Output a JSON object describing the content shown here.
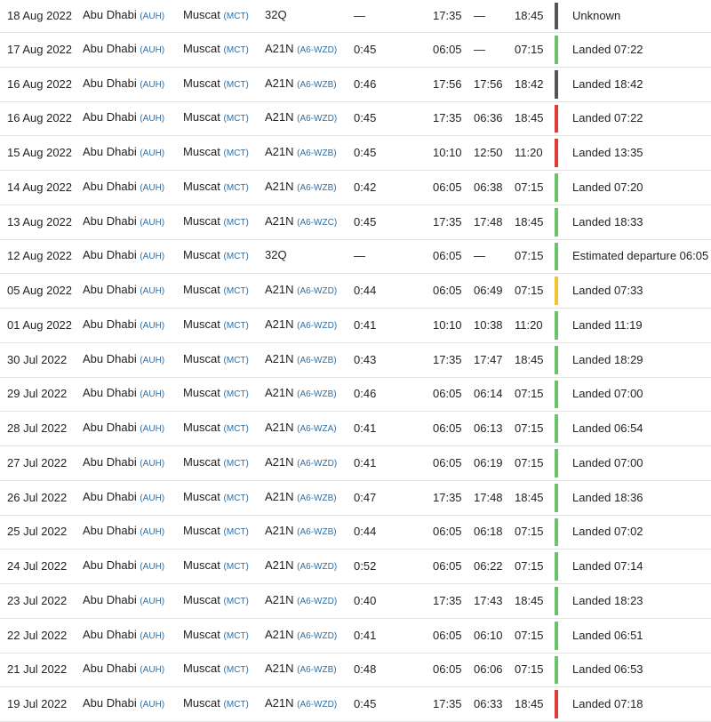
{
  "colors": {
    "grey": "#555555",
    "green": "#6cc26c",
    "red": "#de3b3b",
    "yellow": "#f1c232",
    "code_link": "#2f6ea3"
  },
  "flights": [
    {
      "date": "18 Aug 2022",
      "from_city": "Abu Dhabi",
      "from_code": "(AUH)",
      "to_city": "Muscat",
      "to_code": "(MCT)",
      "aircraft": "32Q",
      "registration": "",
      "duration": "—",
      "std": "17:35",
      "atd": "—",
      "sta": "18:45",
      "status": "Unknown",
      "status_color": "grey"
    },
    {
      "date": "17 Aug 2022",
      "from_city": "Abu Dhabi",
      "from_code": "(AUH)",
      "to_city": "Muscat",
      "to_code": "(MCT)",
      "aircraft": "A21N",
      "registration": "(A6-WZD)",
      "duration": "0:45",
      "std": "06:05",
      "atd": "—",
      "sta": "07:15",
      "status": "Landed 07:22",
      "status_color": "green"
    },
    {
      "date": "16 Aug 2022",
      "from_city": "Abu Dhabi",
      "from_code": "(AUH)",
      "to_city": "Muscat",
      "to_code": "(MCT)",
      "aircraft": "A21N",
      "registration": "(A6-WZB)",
      "duration": "0:46",
      "std": "17:56",
      "atd": "17:56",
      "sta": "18:42",
      "status": "Landed 18:42",
      "status_color": "grey"
    },
    {
      "date": "16 Aug 2022",
      "from_city": "Abu Dhabi",
      "from_code": "(AUH)",
      "to_city": "Muscat",
      "to_code": "(MCT)",
      "aircraft": "A21N",
      "registration": "(A6-WZD)",
      "duration": "0:45",
      "std": "17:35",
      "atd": "06:36",
      "sta": "18:45",
      "status": "Landed 07:22",
      "status_color": "red"
    },
    {
      "date": "15 Aug 2022",
      "from_city": "Abu Dhabi",
      "from_code": "(AUH)",
      "to_city": "Muscat",
      "to_code": "(MCT)",
      "aircraft": "A21N",
      "registration": "(A6-WZB)",
      "duration": "0:45",
      "std": "10:10",
      "atd": "12:50",
      "sta": "11:20",
      "status": "Landed 13:35",
      "status_color": "red"
    },
    {
      "date": "14 Aug 2022",
      "from_city": "Abu Dhabi",
      "from_code": "(AUH)",
      "to_city": "Muscat",
      "to_code": "(MCT)",
      "aircraft": "A21N",
      "registration": "(A6-WZB)",
      "duration": "0:42",
      "std": "06:05",
      "atd": "06:38",
      "sta": "07:15",
      "status": "Landed 07:20",
      "status_color": "green"
    },
    {
      "date": "13 Aug 2022",
      "from_city": "Abu Dhabi",
      "from_code": "(AUH)",
      "to_city": "Muscat",
      "to_code": "(MCT)",
      "aircraft": "A21N",
      "registration": "(A6-WZC)",
      "duration": "0:45",
      "std": "17:35",
      "atd": "17:48",
      "sta": "18:45",
      "status": "Landed 18:33",
      "status_color": "green"
    },
    {
      "date": "12 Aug 2022",
      "from_city": "Abu Dhabi",
      "from_code": "(AUH)",
      "to_city": "Muscat",
      "to_code": "(MCT)",
      "aircraft": "32Q",
      "registration": "",
      "duration": "—",
      "std": "06:05",
      "atd": "—",
      "sta": "07:15",
      "status": "Estimated departure 06:05",
      "status_color": "green"
    },
    {
      "date": "05 Aug 2022",
      "from_city": "Abu Dhabi",
      "from_code": "(AUH)",
      "to_city": "Muscat",
      "to_code": "(MCT)",
      "aircraft": "A21N",
      "registration": "(A6-WZD)",
      "duration": "0:44",
      "std": "06:05",
      "atd": "06:49",
      "sta": "07:15",
      "status": "Landed 07:33",
      "status_color": "yellow"
    },
    {
      "date": "01 Aug 2022",
      "from_city": "Abu Dhabi",
      "from_code": "(AUH)",
      "to_city": "Muscat",
      "to_code": "(MCT)",
      "aircraft": "A21N",
      "registration": "(A6-WZD)",
      "duration": "0:41",
      "std": "10:10",
      "atd": "10:38",
      "sta": "11:20",
      "status": "Landed 11:19",
      "status_color": "green"
    },
    {
      "date": "30 Jul 2022",
      "from_city": "Abu Dhabi",
      "from_code": "(AUH)",
      "to_city": "Muscat",
      "to_code": "(MCT)",
      "aircraft": "A21N",
      "registration": "(A6-WZB)",
      "duration": "0:43",
      "std": "17:35",
      "atd": "17:47",
      "sta": "18:45",
      "status": "Landed 18:29",
      "status_color": "green"
    },
    {
      "date": "29 Jul 2022",
      "from_city": "Abu Dhabi",
      "from_code": "(AUH)",
      "to_city": "Muscat",
      "to_code": "(MCT)",
      "aircraft": "A21N",
      "registration": "(A6-WZB)",
      "duration": "0:46",
      "std": "06:05",
      "atd": "06:14",
      "sta": "07:15",
      "status": "Landed 07:00",
      "status_color": "green"
    },
    {
      "date": "28 Jul 2022",
      "from_city": "Abu Dhabi",
      "from_code": "(AUH)",
      "to_city": "Muscat",
      "to_code": "(MCT)",
      "aircraft": "A21N",
      "registration": "(A6-WZA)",
      "duration": "0:41",
      "std": "06:05",
      "atd": "06:13",
      "sta": "07:15",
      "status": "Landed 06:54",
      "status_color": "green"
    },
    {
      "date": "27 Jul 2022",
      "from_city": "Abu Dhabi",
      "from_code": "(AUH)",
      "to_city": "Muscat",
      "to_code": "(MCT)",
      "aircraft": "A21N",
      "registration": "(A6-WZD)",
      "duration": "0:41",
      "std": "06:05",
      "atd": "06:19",
      "sta": "07:15",
      "status": "Landed 07:00",
      "status_color": "green"
    },
    {
      "date": "26 Jul 2022",
      "from_city": "Abu Dhabi",
      "from_code": "(AUH)",
      "to_city": "Muscat",
      "to_code": "(MCT)",
      "aircraft": "A21N",
      "registration": "(A6-WZB)",
      "duration": "0:47",
      "std": "17:35",
      "atd": "17:48",
      "sta": "18:45",
      "status": "Landed 18:36",
      "status_color": "green"
    },
    {
      "date": "25 Jul 2022",
      "from_city": "Abu Dhabi",
      "from_code": "(AUH)",
      "to_city": "Muscat",
      "to_code": "(MCT)",
      "aircraft": "A21N",
      "registration": "(A6-WZB)",
      "duration": "0:44",
      "std": "06:05",
      "atd": "06:18",
      "sta": "07:15",
      "status": "Landed 07:02",
      "status_color": "green"
    },
    {
      "date": "24 Jul 2022",
      "from_city": "Abu Dhabi",
      "from_code": "(AUH)",
      "to_city": "Muscat",
      "to_code": "(MCT)",
      "aircraft": "A21N",
      "registration": "(A6-WZD)",
      "duration": "0:52",
      "std": "06:05",
      "atd": "06:22",
      "sta": "07:15",
      "status": "Landed 07:14",
      "status_color": "green"
    },
    {
      "date": "23 Jul 2022",
      "from_city": "Abu Dhabi",
      "from_code": "(AUH)",
      "to_city": "Muscat",
      "to_code": "(MCT)",
      "aircraft": "A21N",
      "registration": "(A6-WZD)",
      "duration": "0:40",
      "std": "17:35",
      "atd": "17:43",
      "sta": "18:45",
      "status": "Landed 18:23",
      "status_color": "green"
    },
    {
      "date": "22 Jul 2022",
      "from_city": "Abu Dhabi",
      "from_code": "(AUH)",
      "to_city": "Muscat",
      "to_code": "(MCT)",
      "aircraft": "A21N",
      "registration": "(A6-WZD)",
      "duration": "0:41",
      "std": "06:05",
      "atd": "06:10",
      "sta": "07:15",
      "status": "Landed 06:51",
      "status_color": "green"
    },
    {
      "date": "21 Jul 2022",
      "from_city": "Abu Dhabi",
      "from_code": "(AUH)",
      "to_city": "Muscat",
      "to_code": "(MCT)",
      "aircraft": "A21N",
      "registration": "(A6-WZB)",
      "duration": "0:48",
      "std": "06:05",
      "atd": "06:06",
      "sta": "07:15",
      "status": "Landed 06:53",
      "status_color": "green"
    },
    {
      "date": "19 Jul 2022",
      "from_city": "Abu Dhabi",
      "from_code": "(AUH)",
      "to_city": "Muscat",
      "to_code": "(MCT)",
      "aircraft": "A21N",
      "registration": "(A6-WZD)",
      "duration": "0:45",
      "std": "17:35",
      "atd": "06:33",
      "sta": "18:45",
      "status": "Landed 07:18",
      "status_color": "red"
    }
  ]
}
